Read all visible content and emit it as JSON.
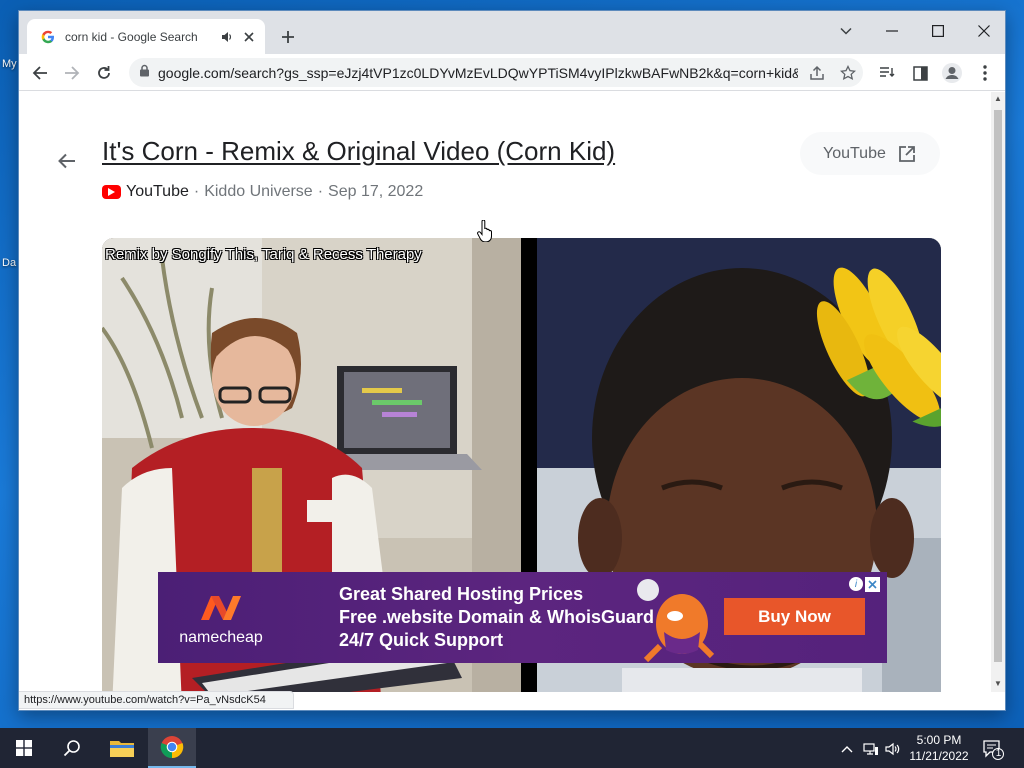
{
  "desktop": {
    "fragments": [
      "My",
      "Da"
    ]
  },
  "browser": {
    "tab": {
      "title": "corn kid - Google Search"
    },
    "omnibox": {
      "url": "google.com/search?gs_ssp=eJzj4tVP1zc0LDYvMzEvLDQwYPTiSM4vyIPlzkwBAFwNB2k&q=corn+kid&..."
    }
  },
  "result": {
    "title": "It's Corn - Remix & Original Video (Corn Kid)",
    "source": "YouTube",
    "channel": "Kiddo Universe",
    "date": "Sep 17, 2022",
    "sep": "·",
    "open_label": "YouTube",
    "video_caption": "Remix by Songify This, Tariq & Recess Therapy"
  },
  "ad": {
    "brand": "namecheap",
    "lines": [
      "Great Shared Hosting Prices",
      "Free .website Domain & WhoisGuard",
      "24/7 Quick Support"
    ],
    "cta": "Buy Now",
    "info": "i"
  },
  "status_bar": {
    "url": "https://www.youtube.com/watch?v=Pa_vNsdcK54"
  },
  "taskbar": {
    "time": "5:00 PM",
    "date": "11/21/2022",
    "notification_count": "1"
  },
  "colors": {
    "ad_background": "#5c257f",
    "ad_cta": "#e8562a",
    "youtube_red": "#ff0000",
    "desktop_blue": "#1570c9",
    "taskbar": "#202534"
  }
}
